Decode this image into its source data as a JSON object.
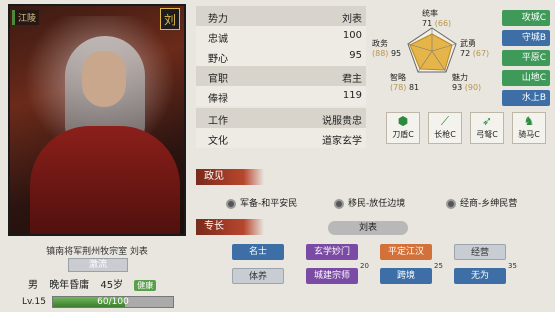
{
  "portrait": {
    "place": "江陵",
    "seal": "刘"
  },
  "profile": {
    "title_line": "镇南将军荆州牧宗室  刘表",
    "status": "激流",
    "gender": "男",
    "age_stage": "晚年昏庸",
    "age": "45岁",
    "health": "健康",
    "level": "Lv.15",
    "exp": "60/100",
    "exp_fraction": 0.6
  },
  "stats": [
    {
      "key": "势力",
      "value": "刘表"
    },
    {
      "key": "忠诚",
      "value": "100"
    },
    {
      "key": "野心",
      "value": "95"
    },
    {
      "key": "官职",
      "value": "君主"
    },
    {
      "key": "俸禄",
      "value": "119"
    },
    {
      "key": "工作",
      "value": "说服贵忠"
    },
    {
      "key": "文化",
      "value": "道家玄学"
    }
  ],
  "radar": {
    "labels": [
      {
        "name": "统率",
        "value": "71",
        "potential": "(66)"
      },
      {
        "name": "武勇",
        "value": "72",
        "potential": "(67)"
      },
      {
        "name": "魅力",
        "value": "93",
        "potential": "(90)"
      },
      {
        "name": "智略",
        "value": "81",
        "potential": "(78)"
      },
      {
        "name": "政务",
        "value": "95",
        "potential": "(88)"
      }
    ],
    "fill_color": "#e6b54a"
  },
  "terrain": [
    {
      "label": "攻城C",
      "color": "#3f9a5a"
    },
    {
      "label": "守城B",
      "color": "#3d6fa6"
    },
    {
      "label": "平原C",
      "color": "#3f9a5a"
    },
    {
      "label": "山地C",
      "color": "#3f9a5a"
    },
    {
      "label": "水上B",
      "color": "#3d6fa6"
    }
  ],
  "weapons": [
    {
      "label": "刀盾C",
      "icon": "shield-icon"
    },
    {
      "label": "长枪C",
      "icon": "spear-icon"
    },
    {
      "label": "弓弩C",
      "icon": "bow-icon"
    },
    {
      "label": "骑马C",
      "icon": "horse-icon"
    }
  ],
  "sections": {
    "policy": "政见",
    "specialty": "专长"
  },
  "policies": [
    "军备-和平安民",
    "移民-放任边境",
    "经商-乡绅民营"
  ],
  "specialty_name": "刘表",
  "skills": [
    {
      "label": "名士",
      "style": "blue"
    },
    {
      "label": "玄学妙门",
      "style": "purple"
    },
    {
      "label": "平定江汉",
      "style": "orange"
    },
    {
      "label": "经营",
      "style": "grey"
    },
    {
      "label": "体养",
      "style": "greyw"
    },
    {
      "label": "城建宗师",
      "style": "purple",
      "badge": "20"
    },
    {
      "label": "跨境",
      "style": "blue",
      "badge": "25"
    },
    {
      "label": "无为",
      "style": "blue",
      "badge": "35"
    }
  ]
}
